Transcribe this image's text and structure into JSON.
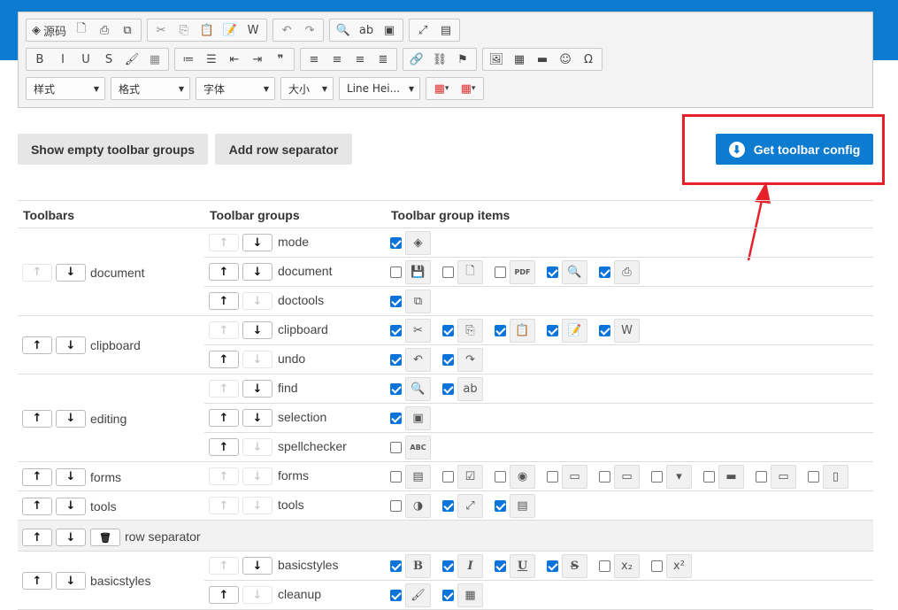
{
  "toolbar": {
    "row1": [
      {
        "name": "source-icon",
        "glyph": "◈",
        "label": "源码"
      },
      {
        "name": "preview-icon",
        "glyph": "🗋"
      },
      {
        "name": "print-icon",
        "glyph": "⎙"
      },
      {
        "name": "templates-icon",
        "glyph": "⧉"
      },
      {
        "name": "cut-icon",
        "glyph": "✂"
      },
      {
        "name": "copy-icon",
        "glyph": "⎘"
      },
      {
        "name": "paste-icon",
        "glyph": "📋"
      },
      {
        "name": "paste-text-icon",
        "glyph": "📝"
      },
      {
        "name": "paste-word-icon",
        "glyph": "W"
      },
      {
        "name": "undo-icon",
        "glyph": "↶"
      },
      {
        "name": "redo-icon",
        "glyph": "↷"
      },
      {
        "name": "find-icon",
        "glyph": "🔍"
      },
      {
        "name": "replace-icon",
        "glyph": "ab"
      },
      {
        "name": "select-all-icon",
        "glyph": "▣"
      },
      {
        "name": "maximize-icon",
        "glyph": "⤢"
      },
      {
        "name": "show-blocks-icon",
        "glyph": "▤"
      }
    ],
    "row2": [
      {
        "name": "bold-icon",
        "glyph": "B"
      },
      {
        "name": "italic-icon",
        "glyph": "I"
      },
      {
        "name": "underline-icon",
        "glyph": "U"
      },
      {
        "name": "strike-icon",
        "glyph": "S"
      },
      {
        "name": "remove-format-icon",
        "glyph": "🖌"
      },
      {
        "name": "copy-format-icon",
        "glyph": "▦"
      },
      {
        "name": "numbered-list-icon",
        "glyph": "≔"
      },
      {
        "name": "bulleted-list-icon",
        "glyph": "☰"
      },
      {
        "name": "outdent-icon",
        "glyph": "⇤"
      },
      {
        "name": "indent-icon",
        "glyph": "⇥"
      },
      {
        "name": "blockquote-icon",
        "glyph": "❞"
      },
      {
        "name": "align-left-icon",
        "glyph": "≡"
      },
      {
        "name": "align-center-icon",
        "glyph": "≡"
      },
      {
        "name": "align-right-icon",
        "glyph": "≡"
      },
      {
        "name": "align-justify-icon",
        "glyph": "≣"
      },
      {
        "name": "link-icon",
        "glyph": "🔗"
      },
      {
        "name": "unlink-icon",
        "glyph": "⛓"
      },
      {
        "name": "anchor-icon",
        "glyph": "⚑"
      },
      {
        "name": "image-icon",
        "glyph": "🖼"
      },
      {
        "name": "table-icon",
        "glyph": "▦"
      },
      {
        "name": "horizontal-rule-icon",
        "glyph": "▬"
      },
      {
        "name": "smiley-icon",
        "glyph": "☺"
      },
      {
        "name": "special-char-icon",
        "glyph": "Ω"
      }
    ],
    "combos": [
      {
        "name": "styles-combo",
        "label": "样式"
      },
      {
        "name": "format-combo",
        "label": "格式"
      },
      {
        "name": "font-combo",
        "label": "字体"
      },
      {
        "name": "size-combo",
        "label": "大小"
      },
      {
        "name": "line-height-combo",
        "label": "Line Hei..."
      }
    ]
  },
  "buttons": {
    "show_empty": "Show empty toolbar groups",
    "add_separator": "Add row separator",
    "get_config": "Get toolbar config"
  },
  "table": {
    "headers": [
      "Toolbars",
      "Toolbar groups",
      "Toolbar group items"
    ]
  },
  "toolbars": [
    {
      "name": "document",
      "groups": [
        {
          "name": "mode",
          "items": [
            {
              "on": true,
              "icon": "source-icon",
              "glyph": "◈"
            }
          ]
        },
        {
          "name": "document",
          "items": [
            {
              "on": false,
              "icon": "save-icon",
              "glyph": "💾"
            },
            {
              "on": false,
              "icon": "new-page-icon",
              "glyph": "🗋"
            },
            {
              "on": false,
              "icon": "export-pdf-icon",
              "glyph": "PDF"
            },
            {
              "on": true,
              "icon": "preview-icon",
              "glyph": "🔍"
            },
            {
              "on": true,
              "icon": "print-icon",
              "glyph": "⎙"
            }
          ]
        },
        {
          "name": "doctools",
          "items": [
            {
              "on": true,
              "icon": "templates-icon",
              "glyph": "⧉"
            }
          ]
        }
      ]
    },
    {
      "name": "clipboard",
      "groups": [
        {
          "name": "clipboard",
          "items": [
            {
              "on": true,
              "icon": "cut-icon",
              "glyph": "✂"
            },
            {
              "on": true,
              "icon": "copy-icon",
              "glyph": "⎘"
            },
            {
              "on": true,
              "icon": "paste-icon",
              "glyph": "📋"
            },
            {
              "on": true,
              "icon": "paste-text-icon",
              "glyph": "📝"
            },
            {
              "on": true,
              "icon": "paste-word-icon",
              "glyph": "W"
            }
          ]
        },
        {
          "name": "undo",
          "items": [
            {
              "on": true,
              "icon": "undo-icon",
              "glyph": "↶"
            },
            {
              "on": true,
              "icon": "redo-icon",
              "glyph": "↷"
            }
          ]
        }
      ]
    },
    {
      "name": "editing",
      "groups": [
        {
          "name": "find",
          "items": [
            {
              "on": true,
              "icon": "find-icon",
              "glyph": "🔍"
            },
            {
              "on": true,
              "icon": "replace-icon",
              "glyph": "ab"
            }
          ]
        },
        {
          "name": "selection",
          "items": [
            {
              "on": true,
              "icon": "select-all-icon",
              "glyph": "▣"
            }
          ]
        },
        {
          "name": "spellchecker",
          "items": [
            {
              "on": false,
              "icon": "spellcheck-icon",
              "glyph": "ABC"
            }
          ]
        }
      ]
    },
    {
      "name": "forms",
      "groups": [
        {
          "name": "forms",
          "items": [
            {
              "on": false,
              "icon": "form-icon",
              "glyph": "▤"
            },
            {
              "on": false,
              "icon": "checkbox-icon",
              "glyph": "☑"
            },
            {
              "on": false,
              "icon": "radio-icon",
              "glyph": "◉"
            },
            {
              "on": false,
              "icon": "text-field-icon",
              "glyph": "▭"
            },
            {
              "on": false,
              "icon": "textarea-icon",
              "glyph": "▭"
            },
            {
              "on": false,
              "icon": "select-icon",
              "glyph": "▾"
            },
            {
              "on": false,
              "icon": "button-icon",
              "glyph": "▬"
            },
            {
              "on": false,
              "icon": "image-button-icon",
              "glyph": "▭"
            },
            {
              "on": false,
              "icon": "hidden-field-icon",
              "glyph": "▯"
            }
          ]
        }
      ]
    },
    {
      "name": "tools",
      "groups": [
        {
          "name": "tools",
          "items": [
            {
              "on": false,
              "icon": "ui-color-icon",
              "glyph": "◑"
            },
            {
              "on": true,
              "icon": "maximize-icon",
              "glyph": "⤢"
            },
            {
              "on": true,
              "icon": "show-blocks-icon",
              "glyph": "▤"
            }
          ]
        }
      ]
    },
    {
      "separator": true,
      "label": "row separator"
    },
    {
      "name": "basicstyles",
      "groups": [
        {
          "name": "basicstyles",
          "items": [
            {
              "on": true,
              "icon": "bold-icon",
              "glyph": "B"
            },
            {
              "on": true,
              "icon": "italic-icon",
              "glyph": "I"
            },
            {
              "on": true,
              "icon": "underline-icon",
              "glyph": "U"
            },
            {
              "on": true,
              "icon": "strike-icon",
              "glyph": "S"
            },
            {
              "on": false,
              "icon": "subscript-icon",
              "glyph": "x₂"
            },
            {
              "on": false,
              "icon": "superscript-icon",
              "glyph": "x²"
            }
          ]
        },
        {
          "name": "cleanup",
          "items": [
            {
              "on": true,
              "icon": "remove-format-icon",
              "glyph": "🖌"
            },
            {
              "on": true,
              "icon": "copy-format-icon",
              "glyph": "▦"
            }
          ]
        }
      ]
    }
  ]
}
